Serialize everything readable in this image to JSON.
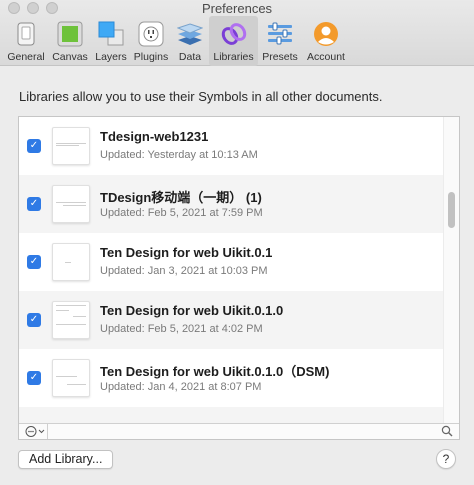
{
  "window": {
    "title": "Preferences"
  },
  "toolbar": {
    "items": [
      {
        "label": "General",
        "icon": "general-icon"
      },
      {
        "label": "Canvas",
        "icon": "canvas-icon"
      },
      {
        "label": "Layers",
        "icon": "layers-icon"
      },
      {
        "label": "Plugins",
        "icon": "plugins-icon"
      },
      {
        "label": "Data",
        "icon": "data-icon"
      },
      {
        "label": "Libraries",
        "icon": "libraries-icon",
        "active": true
      },
      {
        "label": "Presets",
        "icon": "presets-icon"
      },
      {
        "label": "Account",
        "icon": "account-icon"
      }
    ]
  },
  "main": {
    "description": "Libraries allow you to use their Symbols in all other documents.",
    "libraries": [
      {
        "name": "Tdesign-web1231",
        "updated": "Updated: Yesterday at 10:13 AM",
        "enabled": true
      },
      {
        "name": "TDesign移动端（一期） (1)",
        "updated": "Updated: Feb 5, 2021 at 7:59 PM",
        "enabled": true
      },
      {
        "name": "Ten Design for web Uikit.0.1",
        "updated": "Updated: Jan 3, 2021 at 10:03 PM",
        "enabled": true
      },
      {
        "name": "Ten Design for web Uikit.0.1.0",
        "updated": "Updated: Feb 5, 2021 at 4:02 PM",
        "enabled": true
      },
      {
        "name": "Ten Design for web Uikit.0.1.0（DSM)",
        "updated": "Updated: Jan 4, 2021 at 8:07 PM",
        "enabled": true
      }
    ],
    "checkmark": "✓",
    "action_menu": "⋯⌄"
  },
  "footer": {
    "add_library_label": "Add Library...",
    "help_label": "?"
  },
  "colors": {
    "accent": "#2f7ae5",
    "active_tab": "#cfcfcf"
  }
}
